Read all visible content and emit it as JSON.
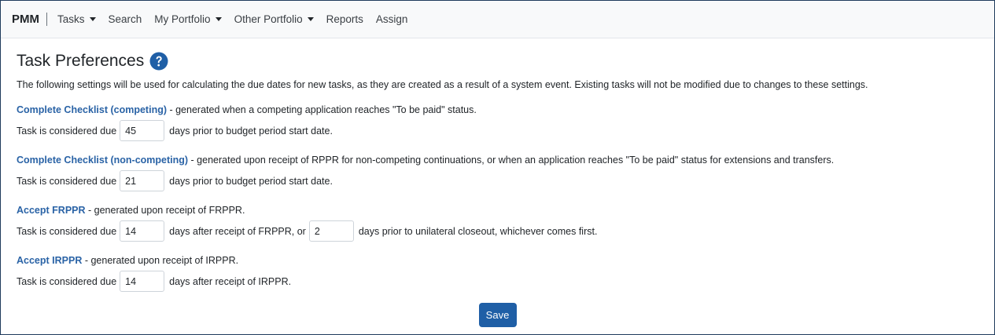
{
  "navbar": {
    "brand": "PMM",
    "items": [
      {
        "label": "Tasks",
        "dropdown": true
      },
      {
        "label": "Search",
        "dropdown": false
      },
      {
        "label": "My Portfolio",
        "dropdown": true
      },
      {
        "label": "Other Portfolio",
        "dropdown": true
      },
      {
        "label": "Reports",
        "dropdown": false
      },
      {
        "label": "Assign",
        "dropdown": false
      }
    ]
  },
  "page": {
    "title": "Task Preferences",
    "help_icon": "question-circle-icon",
    "intro": "The following settings will be used for calculating the due dates for new tasks, as they are created as a result of a system event. Existing tasks will not be modified due to changes to these settings."
  },
  "sections": [
    {
      "title": "Complete Checklist (competing)",
      "description": " - generated when a competing application reaches \"To be paid\" status.",
      "prefix": "Task is considered due",
      "value1": "45",
      "text1": "days prior to budget period start date."
    },
    {
      "title": "Complete Checklist (non-competing)",
      "description": " - generated upon receipt of RPPR for non-competing continuations, or when an application reaches \"To be paid\" status for extensions and transfers.",
      "prefix": "Task is considered due",
      "value1": "21",
      "text1": "days prior to budget period start date."
    },
    {
      "title": "Accept FRPPR",
      "description": " - generated upon receipt of FRPPR.",
      "prefix": "Task is considered due",
      "value1": "14",
      "text1": "days after receipt of FRPPR, or",
      "value2": "2",
      "text2": "days prior to unilateral closeout, whichever comes first."
    },
    {
      "title": "Accept IRPPR",
      "description": " - generated upon receipt of IRPPR.",
      "prefix": "Task is considered due",
      "value1": "14",
      "text1": "days after receipt of IRPPR."
    }
  ],
  "actions": {
    "save_label": "Save"
  },
  "colors": {
    "accent": "#1f5fa6",
    "link": "#2a63a6",
    "navbar_bg": "#f8f9fa"
  }
}
